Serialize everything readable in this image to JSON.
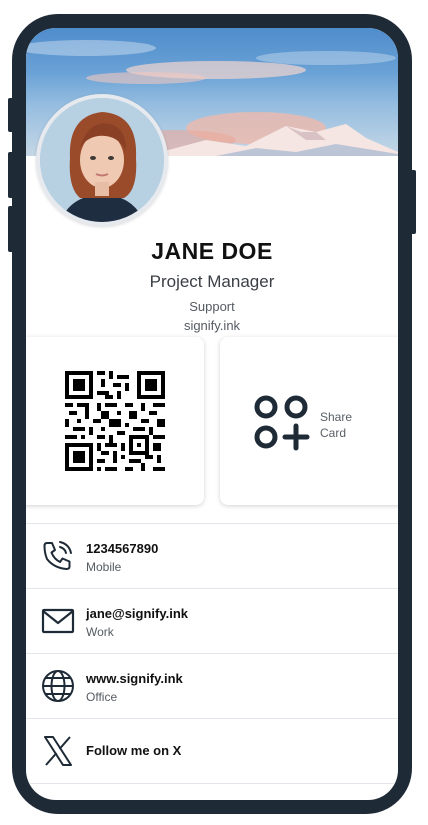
{
  "profile": {
    "name": "JANE DOE",
    "title": "Project Manager",
    "department": "Support",
    "company": "signify.ink"
  },
  "share_card": {
    "label_line1": "Share",
    "label_line2": "Card",
    "icon": "share-card-icon"
  },
  "contacts": [
    {
      "icon": "phone-icon",
      "value": "1234567890",
      "label": "Mobile"
    },
    {
      "icon": "mail-icon",
      "value": "jane@signify.ink",
      "label": "Work"
    },
    {
      "icon": "globe-icon",
      "value": "www.signify.ink",
      "label": "Office"
    },
    {
      "icon": "x-logo-icon",
      "value": "Follow me on X"
    }
  ],
  "colors": {
    "frame": "#1f2a37",
    "text_primary": "#111111",
    "text_secondary": "#555b62",
    "divider": "#e3e6ea"
  }
}
